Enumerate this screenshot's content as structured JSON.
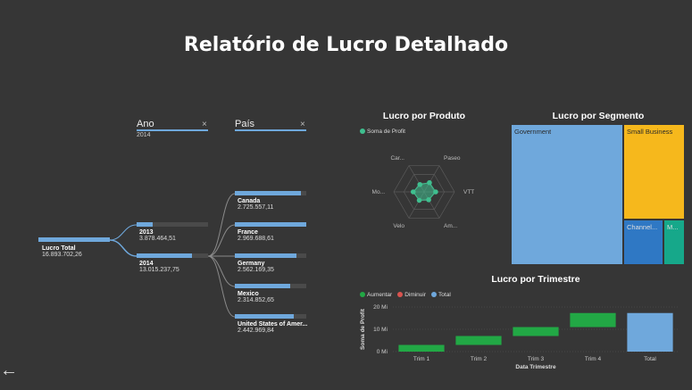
{
  "report": {
    "title": "Relatório de Lucro Detalhado"
  },
  "decomp": {
    "levels": [
      {
        "name": "Ano",
        "filter": "2014",
        "close": "×"
      },
      {
        "name": "País",
        "close": "×"
      }
    ],
    "root": {
      "label": "Lucro Total",
      "value": "16.893.702,26"
    },
    "years": [
      {
        "label": "2013",
        "value": "3.878.464,51",
        "fraction": 0.23
      },
      {
        "label": "2014",
        "value": "13.015.237,75",
        "fraction": 0.77
      }
    ],
    "countries": [
      {
        "label": "Canada",
        "value": "2.725.557,11",
        "fraction": 0.93
      },
      {
        "label": "France",
        "value": "2.969.688,61",
        "fraction": 1.0
      },
      {
        "label": "Germany",
        "value": "2.562.169,35",
        "fraction": 0.86
      },
      {
        "label": "Mexico",
        "value": "2.314.852,65",
        "fraction": 0.78
      },
      {
        "label": "United States of Amer...",
        "value": "2.442.969,84",
        "fraction": 0.82
      }
    ]
  },
  "radar": {
    "title": "Lucro por Produto",
    "legend": "Soma de Profit",
    "color": "#3fbf8f",
    "axes": [
      "Paseo",
      "VTT",
      "Am...",
      "Velo",
      "Mo...",
      "Car..."
    ],
    "values": [
      0.35,
      0.38,
      0.3,
      0.32,
      0.36,
      0.28
    ]
  },
  "treemap": {
    "title": "Lucro por Segmento",
    "cells": [
      {
        "label": "Government",
        "color": "#6fa8dc"
      },
      {
        "label": "Small Business",
        "color": "#f6b81c"
      },
      {
        "label": "Channel...",
        "color": "#2f78c4"
      },
      {
        "label": "M...",
        "color": "#16a88a"
      }
    ]
  },
  "waterfall": {
    "title": "Lucro por Trimestre",
    "legend": [
      {
        "label": "Aumentar",
        "color": "#22a845"
      },
      {
        "label": "Diminuir",
        "color": "#d9534f"
      },
      {
        "label": "Total",
        "color": "#6fa8dc"
      }
    ],
    "ylabel": "Soma de Profit",
    "xlabel": "Data Trimestre",
    "yticks": [
      "0 Mi",
      "10 Mi",
      "20 Mi"
    ]
  },
  "chart_data": {
    "type": "bar",
    "title": "Lucro por Trimestre",
    "xlabel": "Data Trimestre",
    "ylabel": "Soma de Profit",
    "categories": [
      "Trim 1",
      "Trim 2",
      "Trim 3",
      "Trim 4",
      "Total"
    ],
    "series": [
      {
        "name": "Aumentar",
        "values": [
          3.0,
          4.0,
          4.0,
          6.3,
          null
        ]
      },
      {
        "name": "Total",
        "values": [
          null,
          null,
          null,
          null,
          17.3
        ]
      }
    ],
    "starts": [
      0,
      3.0,
      7.0,
      11.0,
      0
    ],
    "ylim": [
      0,
      20
    ]
  }
}
